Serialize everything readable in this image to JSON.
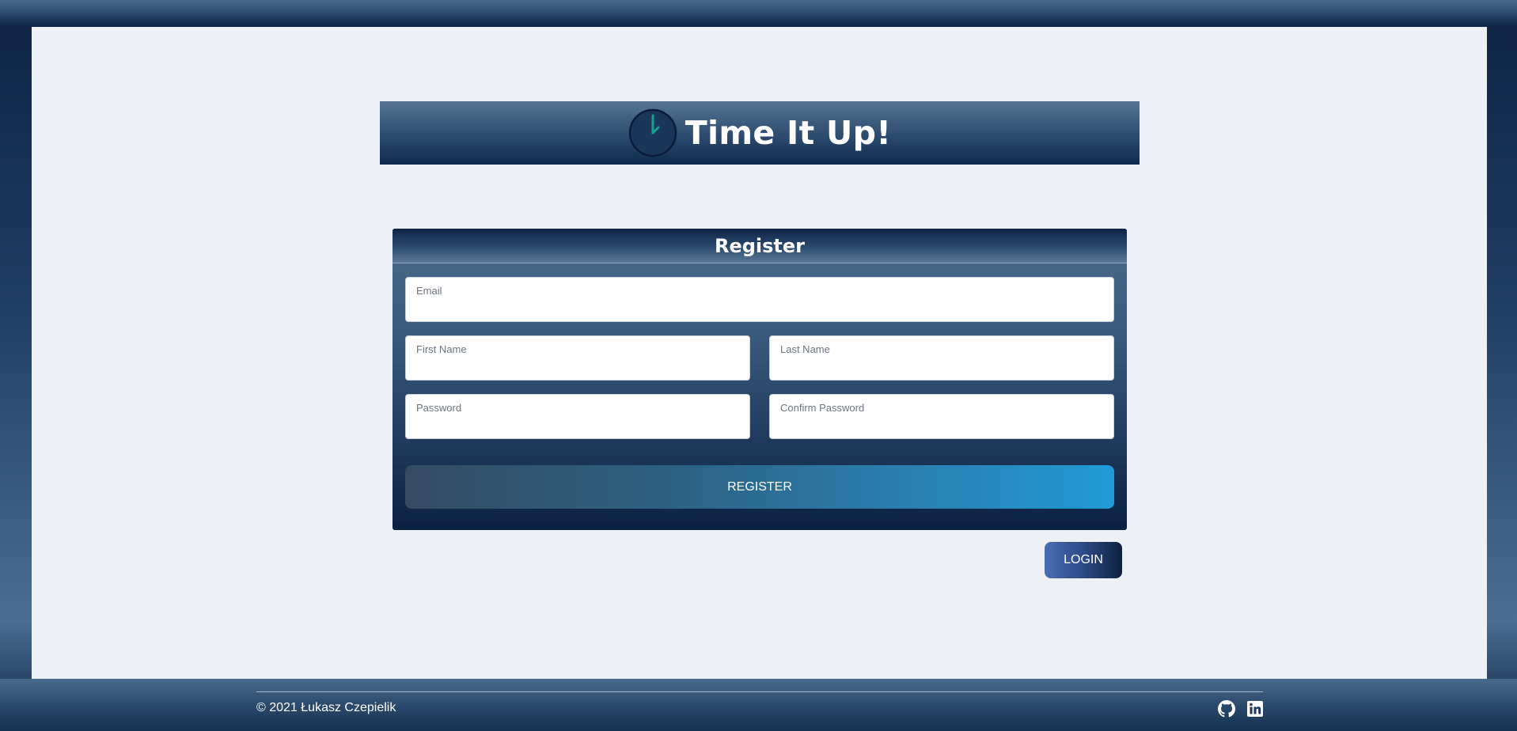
{
  "brand": {
    "title": "Time It Up!",
    "icon": "clock-icon"
  },
  "register_form": {
    "title": "Register",
    "fields": {
      "email": {
        "label": "Email",
        "value": ""
      },
      "first_name": {
        "label": "First Name",
        "value": ""
      },
      "last_name": {
        "label": "Last Name",
        "value": ""
      },
      "password": {
        "label": "Password",
        "value": ""
      },
      "confirm_password": {
        "label": "Confirm Password",
        "value": ""
      }
    },
    "submit_label": "REGISTER"
  },
  "login_button": {
    "label": "LOGIN"
  },
  "footer": {
    "copyright": "© 2021 Łukasz Czepielik",
    "social": [
      "github-icon",
      "linkedin-icon"
    ]
  },
  "colors": {
    "brand_navy": "#0d2344",
    "accent_blue": "#219ad6",
    "clock_hand": "#17a08c",
    "panel_bg": "#edf1f5"
  }
}
